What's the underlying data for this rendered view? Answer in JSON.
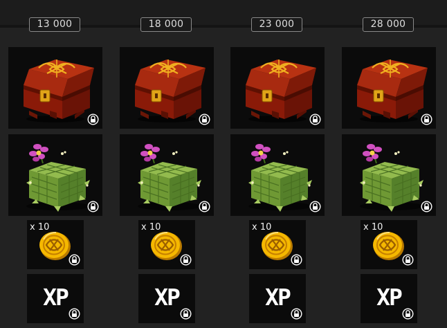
{
  "reward_track": {
    "columns": [
      {
        "threshold": "13 000",
        "coin_quantity": "x 10",
        "xp_label": "XP"
      },
      {
        "threshold": "18 000",
        "coin_quantity": "x 10",
        "xp_label": "XP"
      },
      {
        "threshold": "23 000",
        "coin_quantity": "x 10",
        "xp_label": "XP"
      },
      {
        "threshold": "28 000",
        "coin_quantity": "x 10",
        "xp_label": "XP"
      }
    ],
    "rewards": [
      {
        "kind": "chest",
        "icon": "treasure-chest-icon",
        "locked": true
      },
      {
        "kind": "plant-block",
        "icon": "flower-bush-icon",
        "locked": true
      },
      {
        "kind": "coin",
        "icon": "gold-coin-icon",
        "locked": true
      },
      {
        "kind": "xp",
        "icon": "xp-icon",
        "locked": true
      }
    ]
  },
  "colors": {
    "background": "#222222",
    "tile": "#0b0b0b",
    "chest": "#8a1a08",
    "chest_emblem": "#f0b020",
    "foliage": "#7aa03a",
    "flower": "#d050c0",
    "coin": "#f5b800"
  }
}
